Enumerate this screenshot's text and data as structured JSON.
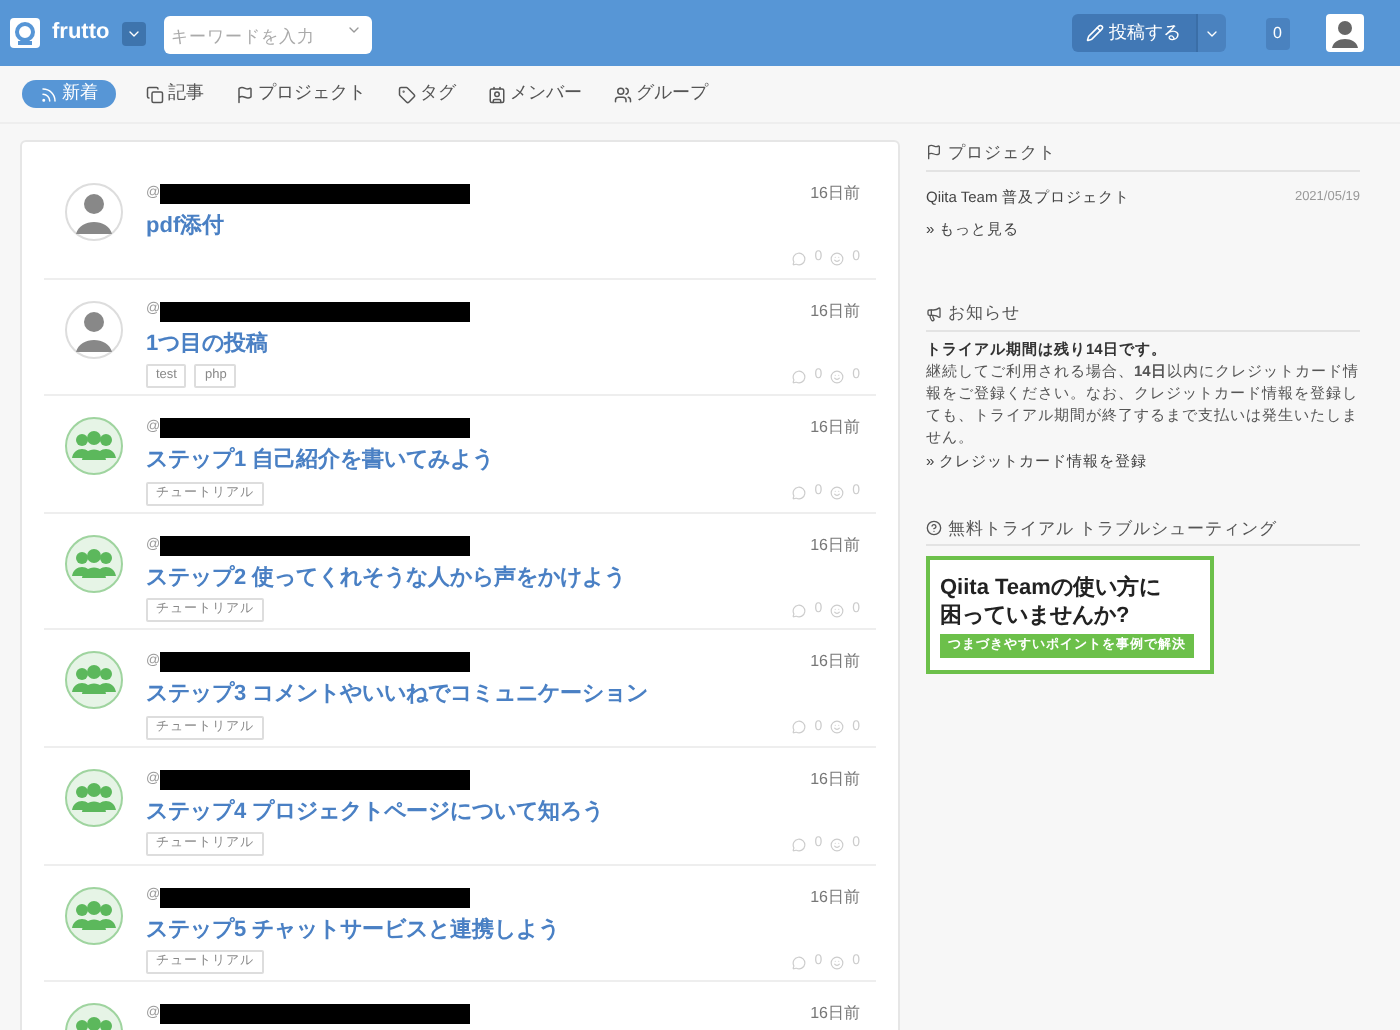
{
  "header": {
    "logo_text": "frutto",
    "search": {
      "placeholder": "キーワードを入力"
    },
    "post_button": "投稿する",
    "notification_count": "0"
  },
  "tabs": [
    {
      "label": "新着",
      "selected": true
    },
    {
      "label": "記事",
      "selected": false
    },
    {
      "label": "プロジェクト",
      "selected": false
    },
    {
      "label": "タグ",
      "selected": false
    },
    {
      "label": "メンバー",
      "selected": false
    },
    {
      "label": "グループ",
      "selected": false
    }
  ],
  "feed": [
    {
      "kind": "person",
      "at": "@",
      "time": "16日前",
      "title": "pdf添付",
      "comments": "0",
      "likes": "0"
    },
    {
      "kind": "person",
      "at": "@",
      "time": "16日前",
      "title": "1つ目の投稿",
      "tags": [
        "test",
        "php"
      ],
      "comments": "0",
      "likes": "0"
    },
    {
      "kind": "group",
      "at": "@",
      "time": "16日前",
      "title": "ステップ1 自己紹介を書いてみよう",
      "tags": [
        "チュートリアル"
      ],
      "comments": "0",
      "likes": "0"
    },
    {
      "kind": "group",
      "at": "@",
      "time": "16日前",
      "title": "ステップ2 使ってくれそうな人から声をかけよう",
      "tags": [
        "チュートリアル"
      ],
      "comments": "0",
      "likes": "0"
    },
    {
      "kind": "group",
      "at": "@",
      "time": "16日前",
      "title": "ステップ3 コメントやいいねでコミュニケーション",
      "tags": [
        "チュートリアル"
      ],
      "comments": "0",
      "likes": "0"
    },
    {
      "kind": "group",
      "at": "@",
      "time": "16日前",
      "title": "ステップ4 プロジェクトページについて知ろう",
      "tags": [
        "チュートリアル"
      ],
      "comments": "0",
      "likes": "0"
    },
    {
      "kind": "group",
      "at": "@",
      "time": "16日前",
      "title": "ステップ5 チャットサービスと連携しよう",
      "tags": [
        "チュートリアル"
      ],
      "comments": "0",
      "likes": "0"
    },
    {
      "kind": "group",
      "at": "@",
      "time": "16日前"
    }
  ],
  "sidebar": {
    "projects": {
      "heading": "プロジェクト",
      "items": [
        {
          "name": "Qiita Team 普及プロジェクト",
          "date": "2021/05/19"
        }
      ],
      "more_link": "» もっと見る"
    },
    "notice": {
      "heading": "お知らせ",
      "lead": "トライアル期間は残り14日です。",
      "body": "継続してご利用される場合、**14日**以内にクレジットカード情報をご登録ください。なお、クレジットカード情報を登録しても、トライアル期間が終了するまで支払いは発生いたしません。",
      "link": "» クレジットカード情報を登録"
    },
    "trouble": {
      "heading": "無料トライアル トラブルシューティング",
      "banner": {
        "line_1": "Qiita Teamの使い方に",
        "line_2": "困っていませんか?",
        "ribbon": "つまづきやすいポイントを事例で解決"
      }
    }
  }
}
